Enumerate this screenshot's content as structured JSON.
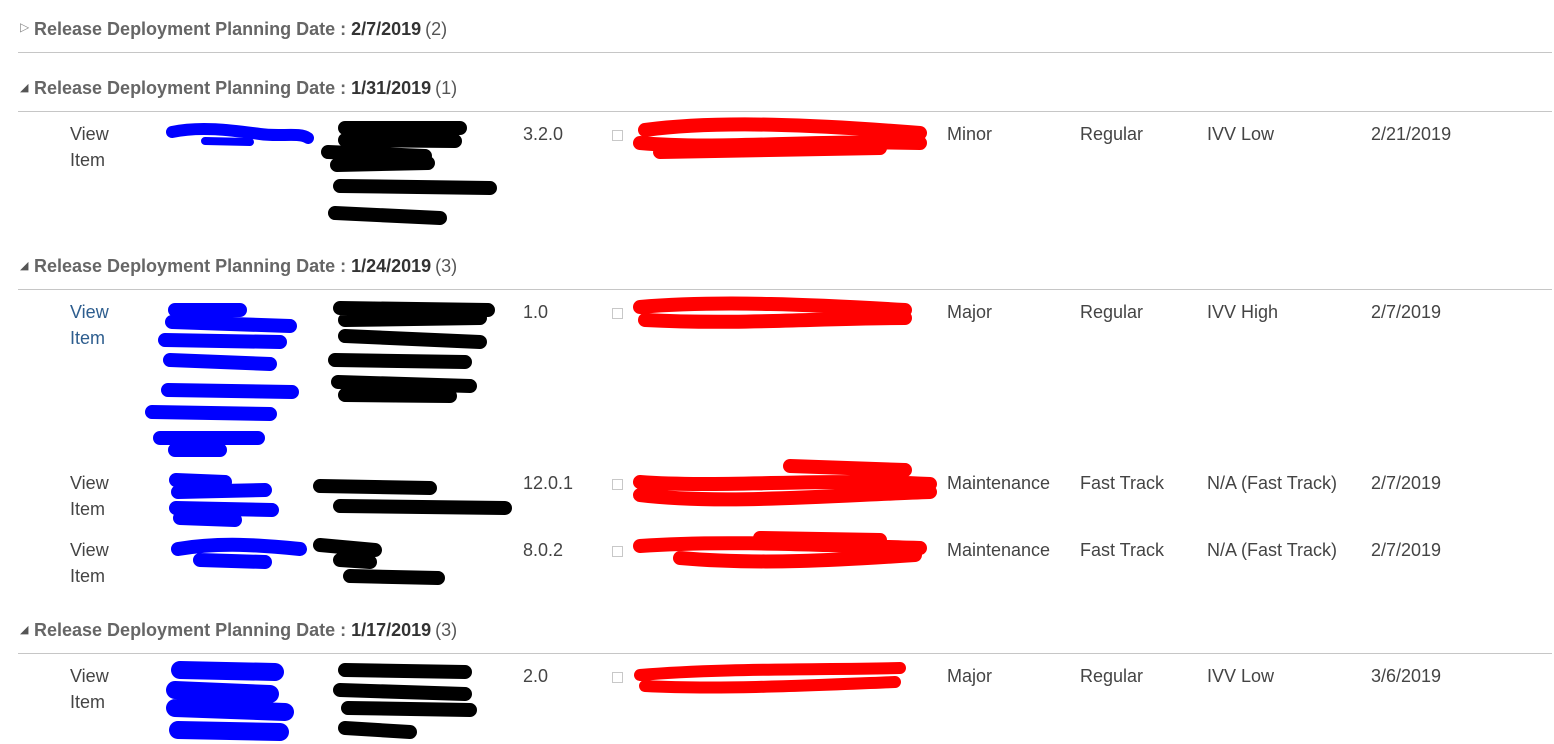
{
  "groups": [
    {
      "label": "Release Deployment Planning Date : ",
      "date": "2/7/2019",
      "count": "(2)",
      "expanded": false,
      "rows": []
    },
    {
      "label": "Release Deployment Planning Date : ",
      "date": "1/31/2019",
      "count": "(1)",
      "expanded": true,
      "rows": [
        {
          "view_line1": "View",
          "view_line2": "Item",
          "version": "3.2.0",
          "release_type": "Minor",
          "track": "Regular",
          "ivv": "IVV Low",
          "date": "2/21/2019"
        }
      ]
    },
    {
      "label": "Release Deployment Planning Date : ",
      "date": "1/24/2019",
      "count": "(3)",
      "expanded": true,
      "rows": [
        {
          "view_line1": "View",
          "view_line2": "Item",
          "version": "1.0",
          "release_type": "Major",
          "track": "Regular",
          "ivv": "IVV High",
          "date": "2/7/2019"
        },
        {
          "view_line1": "View",
          "view_line2": "Item",
          "version": "12.0.1",
          "release_type": "Maintenance",
          "track": "Fast Track",
          "ivv": "N/A (Fast Track)",
          "date": "2/7/2019"
        },
        {
          "view_line1": "View",
          "view_line2": "Item",
          "version": "8.0.2",
          "release_type": "Maintenance",
          "track": "Fast Track",
          "ivv": "N/A (Fast Track)",
          "date": "2/7/2019"
        }
      ]
    },
    {
      "label": "Release Deployment Planning Date : ",
      "date": "1/17/2019",
      "count": "(3)",
      "expanded": true,
      "rows": [
        {
          "view_line1": "View",
          "view_line2": "Item",
          "version": "2.0",
          "release_type": "Major",
          "track": "Regular",
          "ivv": "IVV Low",
          "date": "3/6/2019"
        }
      ]
    }
  ],
  "redaction_colors": {
    "blue": "#0000ff",
    "black": "#000000",
    "red": "#ff0000"
  }
}
